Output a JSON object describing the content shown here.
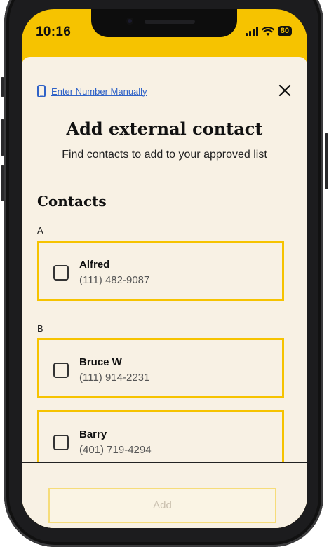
{
  "status_bar": {
    "time": "10:16",
    "battery": "80"
  },
  "header": {
    "manual_link_label": "Enter Number Manually",
    "title": "Add external contact",
    "subtitle": "Find contacts to add to your approved list"
  },
  "contacts": {
    "section_title": "Contacts",
    "groups": [
      {
        "letter": "A",
        "items": [
          {
            "name": "Alfred",
            "phone": "(111) 482-9087"
          }
        ]
      },
      {
        "letter": "B",
        "items": [
          {
            "name": "Bruce W",
            "phone": "(111) 914-2231"
          },
          {
            "name": "Barry",
            "phone": "(401) 719-4294"
          }
        ]
      }
    ]
  },
  "footer": {
    "add_label": "Add"
  },
  "colors": {
    "accent": "#f6c300",
    "background": "#f8f1e4",
    "link": "#2f62c7"
  }
}
